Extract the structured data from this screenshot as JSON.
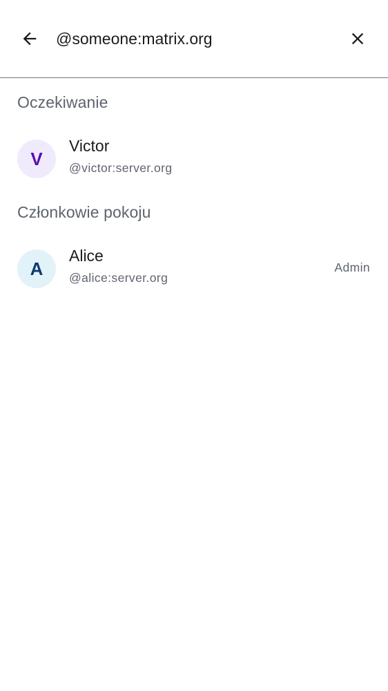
{
  "search": {
    "query": "@someone:matrix.org"
  },
  "icons": {
    "back": "arrow-back-icon",
    "clear": "close-icon"
  },
  "sections": [
    {
      "title": "Oczekiwanie",
      "members": [
        {
          "initial": "V",
          "name": "Victor",
          "user_id": "@victor:server.org",
          "role": "",
          "avatar_bg": "#f0ebfc",
          "avatar_fg": "#5a0fb0"
        }
      ]
    },
    {
      "title": "Członkowie pokoju",
      "members": [
        {
          "initial": "A",
          "name": "Alice",
          "user_id": "@alice:server.org",
          "role": "Admin",
          "avatar_bg": "#e1f3f9",
          "avatar_fg": "#0f3a6b"
        }
      ]
    }
  ],
  "colors": {
    "text_primary": "#1b1b1f",
    "text_secondary": "#5e636e",
    "divider": "#6f7480"
  }
}
